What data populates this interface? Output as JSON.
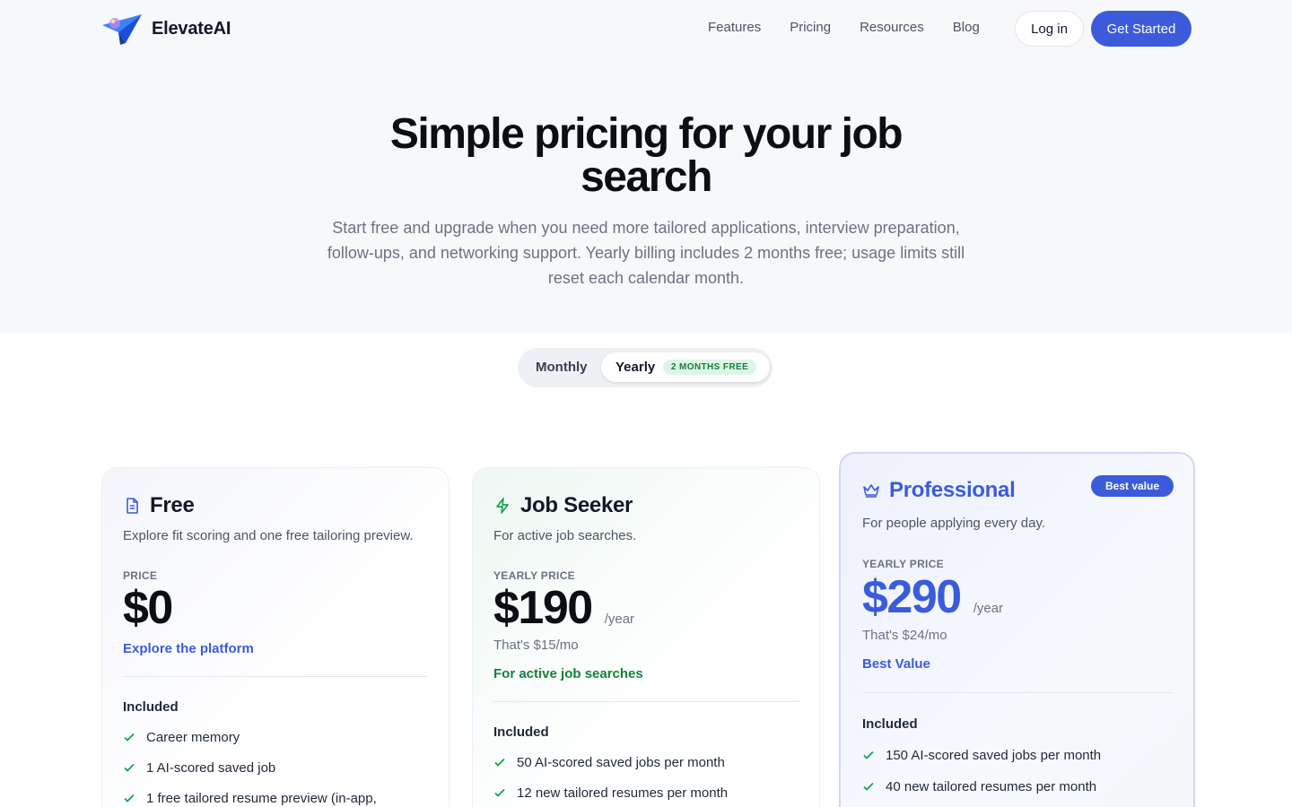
{
  "brand": {
    "name": "ElevateAI",
    "accent": "#3b5bdb",
    "success": "#15803d"
  },
  "nav": {
    "links": [
      "Features",
      "Pricing",
      "Resources",
      "Blog"
    ],
    "login": "Log in",
    "cta": "Get Started"
  },
  "hero": {
    "title": "Simple pricing for your job search",
    "subtitle": "Start free and upgrade when you need more tailored applications, interview preparation, follow-ups, and networking support. Yearly billing includes 2 months free; usage limits still reset each calendar month."
  },
  "billing_toggle": {
    "monthly": "Monthly",
    "yearly": "Yearly",
    "yearly_badge": "2 MONTHS FREE",
    "selected": "Yearly"
  },
  "plans": [
    {
      "name": "Free",
      "icon": "document-icon",
      "description": "Explore fit scoring and one free tailoring preview.",
      "price_label": "PRICE",
      "price": "$0",
      "tagline": "Explore the platform",
      "included_label": "Included",
      "features": [
        "Career memory",
        "1 AI-scored saved job",
        "1 free tailored resume preview (in-app,"
      ]
    },
    {
      "name": "Job Seeker",
      "icon": "lightning-icon",
      "description": "For active job searches.",
      "price_label": "YEARLY PRICE",
      "price": "$190",
      "period": "/year",
      "monthly_equivalent": "That's $15/mo",
      "tagline": "For active job searches",
      "included_label": "Included",
      "features": [
        "50 AI-scored saved jobs per month",
        "12 new tailored resumes per month"
      ]
    },
    {
      "name": "Professional",
      "icon": "crown-icon",
      "badge": "Best value",
      "description": "For people applying every day.",
      "price_label": "YEARLY PRICE",
      "price": "$290",
      "period": "/year",
      "monthly_equivalent": "That's $24/mo",
      "tagline": "Best Value",
      "included_label": "Included",
      "features": [
        "150 AI-scored saved jobs per month",
        "40 new tailored resumes per month"
      ]
    }
  ]
}
